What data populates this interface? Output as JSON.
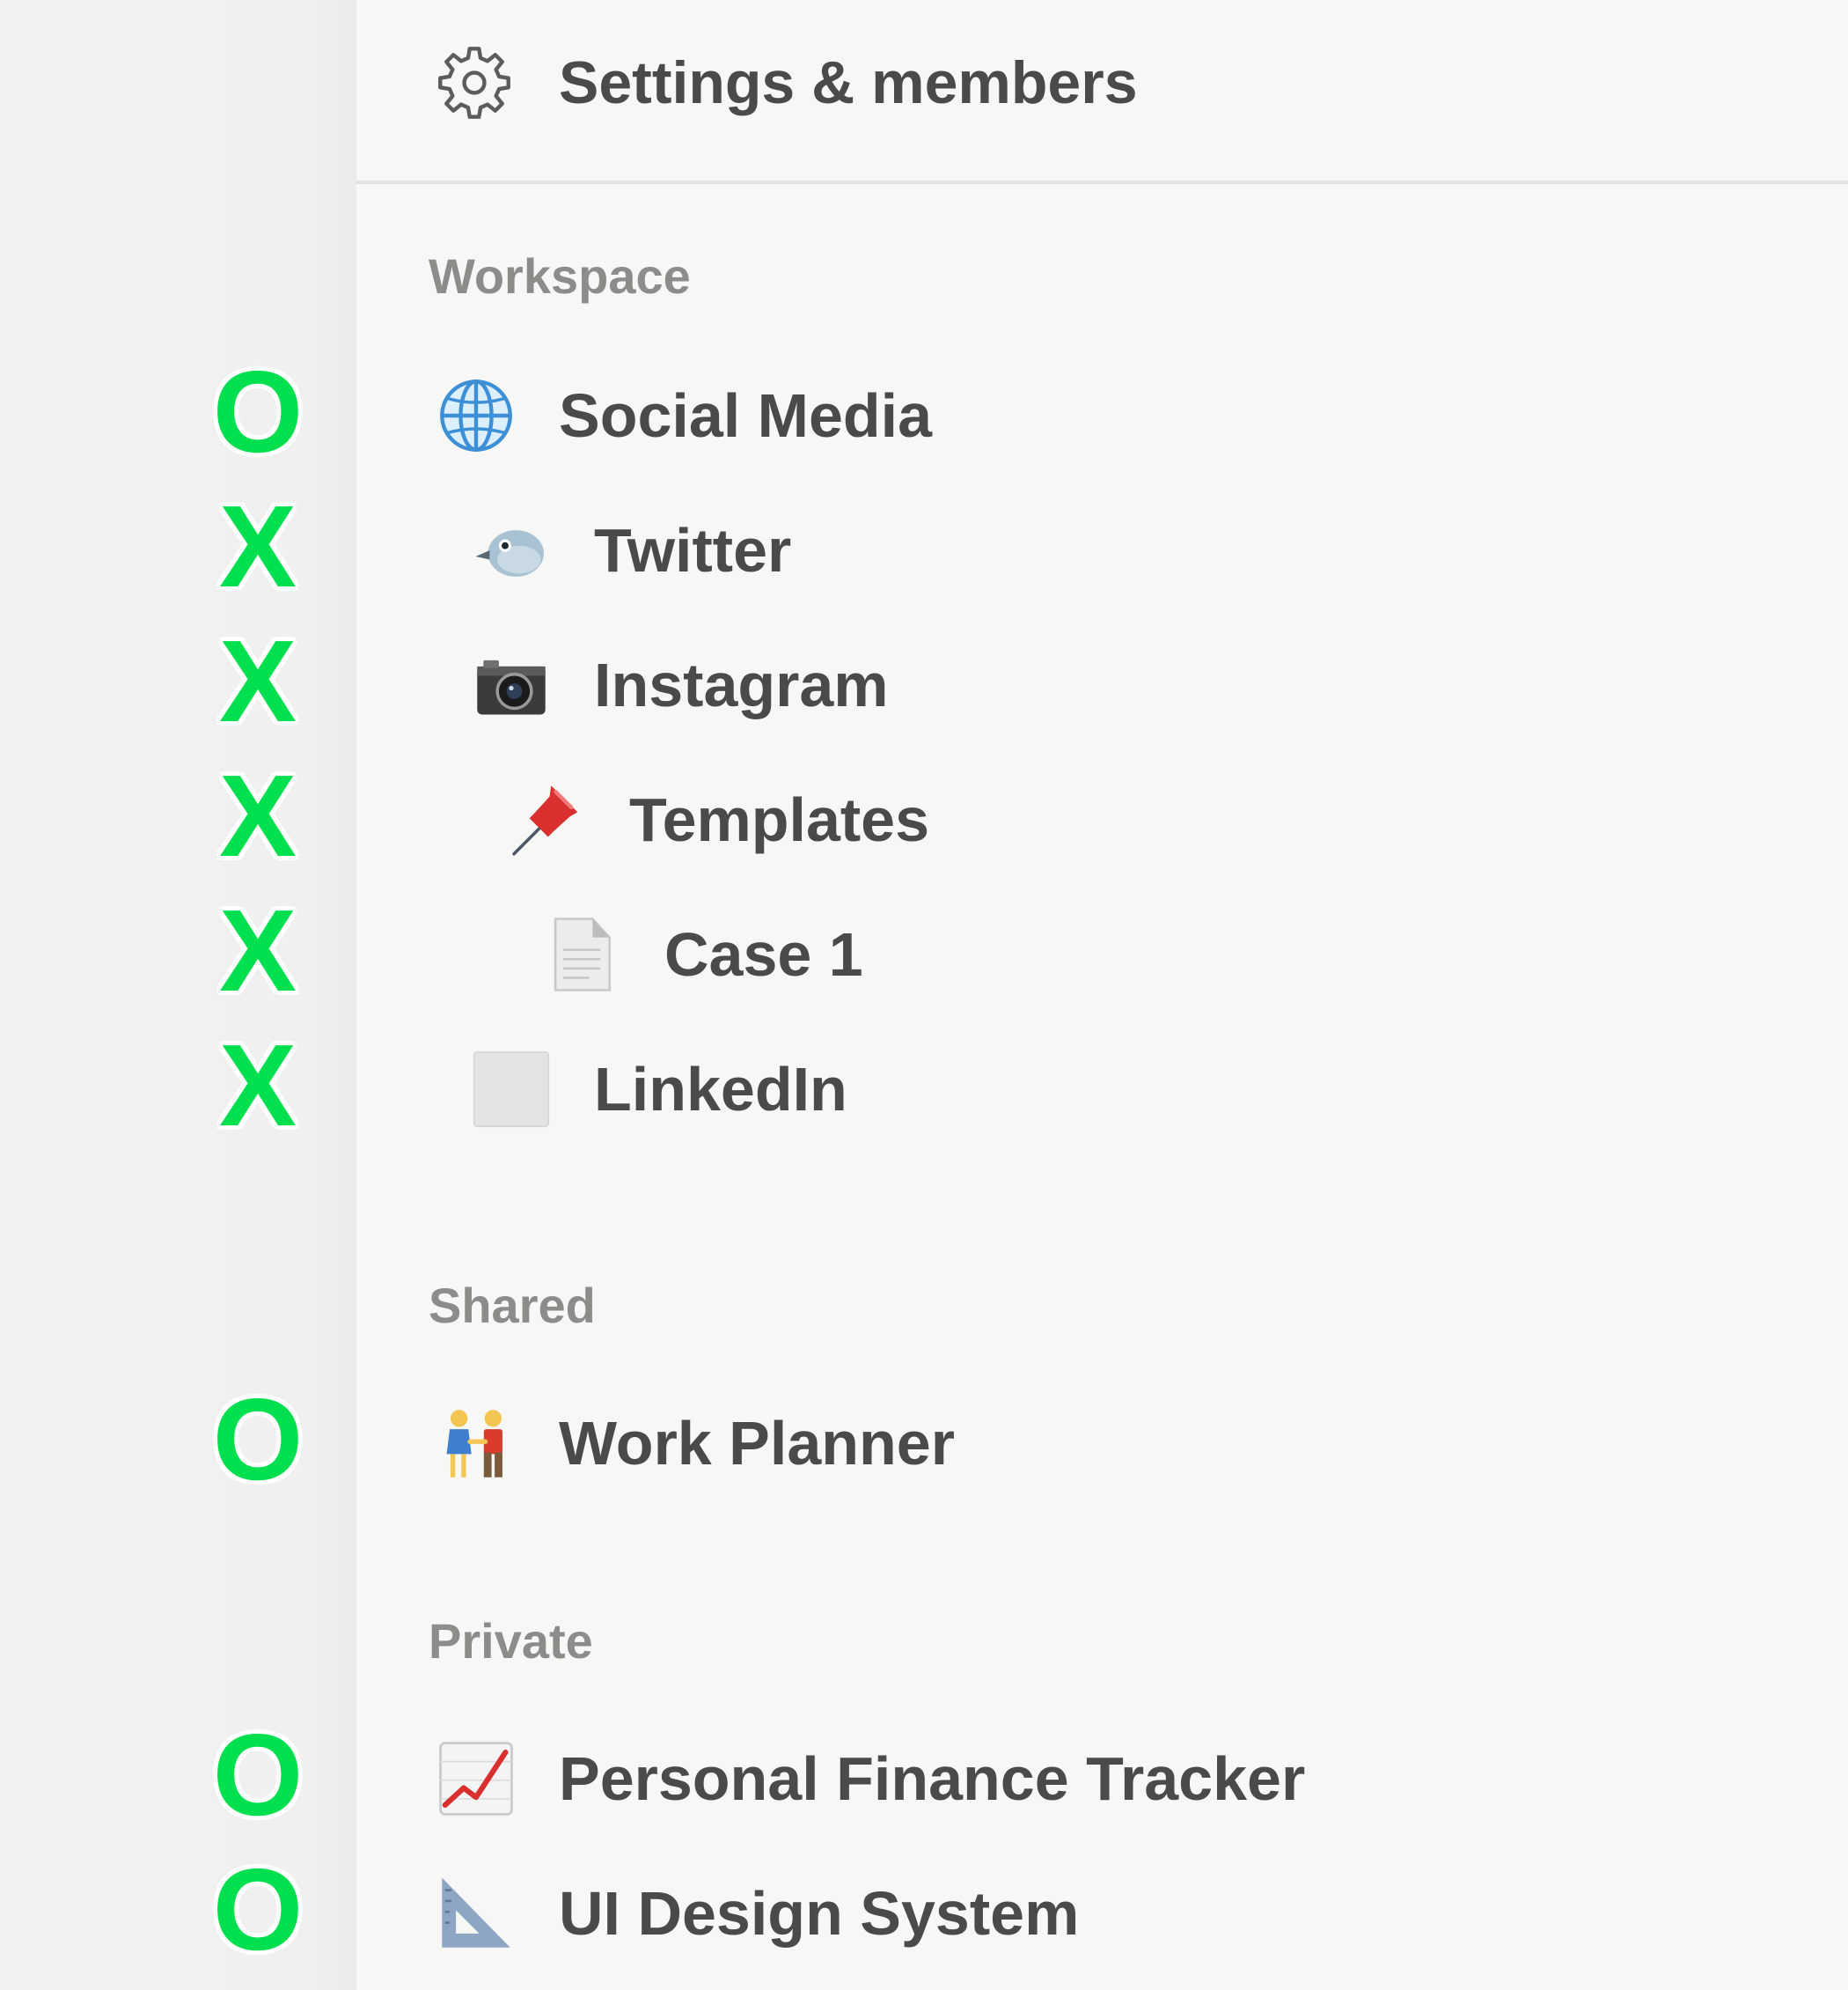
{
  "settings": {
    "label": "Settings & members",
    "icon": "gear-icon"
  },
  "sections": {
    "workspace": {
      "label": "Workspace",
      "items": [
        {
          "label": "Social Media",
          "icon": "globe-icon",
          "marker": "O"
        },
        {
          "label": "Twitter",
          "icon": "bird-icon",
          "marker": "X"
        },
        {
          "label": "Instagram",
          "icon": "camera-icon",
          "marker": "X"
        },
        {
          "label": "Templates",
          "icon": "pushpin-icon",
          "marker": "X"
        },
        {
          "label": "Case 1",
          "icon": "page-icon",
          "marker": "X"
        },
        {
          "label": "LinkedIn",
          "icon": "blank-page-icon",
          "marker": "X"
        }
      ]
    },
    "shared": {
      "label": "Shared",
      "items": [
        {
          "label": "Work Planner",
          "icon": "couple-icon",
          "marker": "O"
        }
      ]
    },
    "private": {
      "label": "Private",
      "items": [
        {
          "label": "Personal Finance Tracker",
          "icon": "chart-increasing-icon",
          "marker": "O"
        },
        {
          "label": "UI Design System",
          "icon": "triangular-ruler-icon",
          "marker": "O"
        }
      ]
    }
  },
  "colors": {
    "marker": "#00e04f",
    "text": "#4a4a48",
    "section_label": "#8c8c89",
    "sidebar_bg": "#f7f7f5"
  }
}
